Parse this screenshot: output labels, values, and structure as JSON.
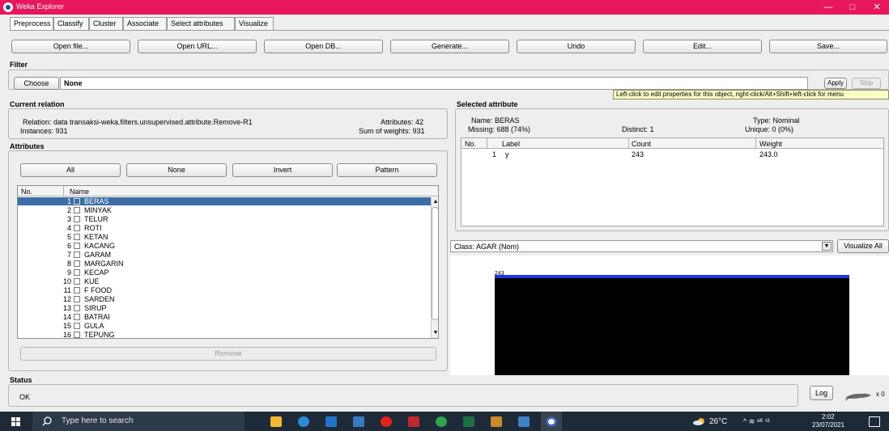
{
  "window": {
    "title": "Weka Explorer",
    "minimize": "—",
    "maximize": "□",
    "close": "✕"
  },
  "tabs": [
    "Preprocess",
    "Classify",
    "Cluster",
    "Associate",
    "Select attributes",
    "Visualize"
  ],
  "toolbar": {
    "open_file": "Open file...",
    "open_url": "Open URL...",
    "open_db": "Open DB...",
    "generate": "Generate...",
    "undo": "Undo",
    "edit": "Edit...",
    "save": "Save..."
  },
  "filter": {
    "title": "Filter",
    "choose": "Choose",
    "value": "None",
    "apply": "Apply",
    "stop": "Stop",
    "tooltip": "Left-click to edit properties for this object, right-click/Alt+Shift+left-click for menu"
  },
  "current_relation": {
    "title": "Current relation",
    "relation": "Relation: data transaksi-weka.filters.unsupervised.attribute.Remove-R1",
    "instances": "Instances: 931",
    "attributes": "Attributes: 42",
    "sum_weights": "Sum of weights: 931"
  },
  "attributes": {
    "title": "Attributes",
    "all": "All",
    "none": "None",
    "invert": "Invert",
    "pattern": "Pattern",
    "col_no": "No.",
    "col_name": "Name",
    "remove": "Remove",
    "items": [
      {
        "no": "1",
        "name": "BERAS"
      },
      {
        "no": "2",
        "name": "MINYAK"
      },
      {
        "no": "3",
        "name": "TELUR"
      },
      {
        "no": "4",
        "name": "ROTI"
      },
      {
        "no": "5",
        "name": "KETAN"
      },
      {
        "no": "6",
        "name": "KACANG"
      },
      {
        "no": "7",
        "name": "GARAM"
      },
      {
        "no": "8",
        "name": "MARGARIN"
      },
      {
        "no": "9",
        "name": "KECAP"
      },
      {
        "no": "10",
        "name": "KUE"
      },
      {
        "no": "11",
        "name": "F FOOD"
      },
      {
        "no": "12",
        "name": "SARDEN"
      },
      {
        "no": "13",
        "name": "SIRUP"
      },
      {
        "no": "14",
        "name": "BATRAI"
      },
      {
        "no": "15",
        "name": "GULA"
      },
      {
        "no": "16",
        "name": "TEPUNG"
      }
    ]
  },
  "selected_attribute": {
    "title": "Selected attribute",
    "name": "Name: BERAS",
    "missing": "Missing: 688 (74%)",
    "distinct": "Distinct: 1",
    "type": "Type: Nominal",
    "unique": "Unique: 0 (0%)",
    "col_no": "No.",
    "col_label": "Label",
    "col_count": "Count",
    "col_weight": "Weight",
    "rows": [
      {
        "no": "1",
        "label": "y",
        "count": "243",
        "weight": "243.0"
      }
    ]
  },
  "class_select": {
    "value": "Class: AGAR (Nom)",
    "visualize_all": "Visualize All"
  },
  "histogram": {
    "bar_label": "243",
    "value": 243,
    "color_top": "#1f36e0"
  },
  "status": {
    "title": "Status",
    "text": "OK",
    "log": "Log",
    "multiplier": "x 0"
  },
  "taskbar": {
    "search_placeholder": "Type here to search",
    "weather": "26°C",
    "tray": "^ ≋ ⁹ᴷ ⁽ᵈ",
    "time": "2:02",
    "date": "23/07/2021"
  }
}
